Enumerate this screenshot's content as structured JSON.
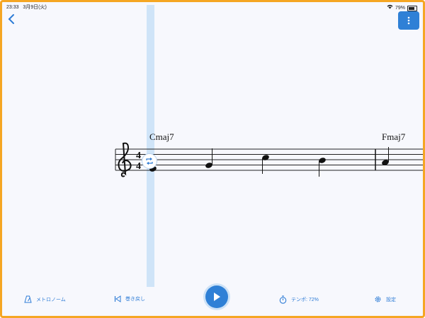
{
  "status_bar": {
    "time": "23:33",
    "date": "3月9日(火)",
    "battery": "79%"
  },
  "score": {
    "time_signature": "4/4",
    "chords": [
      "Cmaj7",
      "Fmaj7"
    ]
  },
  "toolbar": {
    "metronome_label": "メトロノーム",
    "rewind_label": "巻き戻し",
    "tempo_label": "テンポ: 72%",
    "settings_label": "設定"
  },
  "colors": {
    "accent": "#2f80d6",
    "border": "#f5a623",
    "playhead": "#cfe4f8"
  }
}
